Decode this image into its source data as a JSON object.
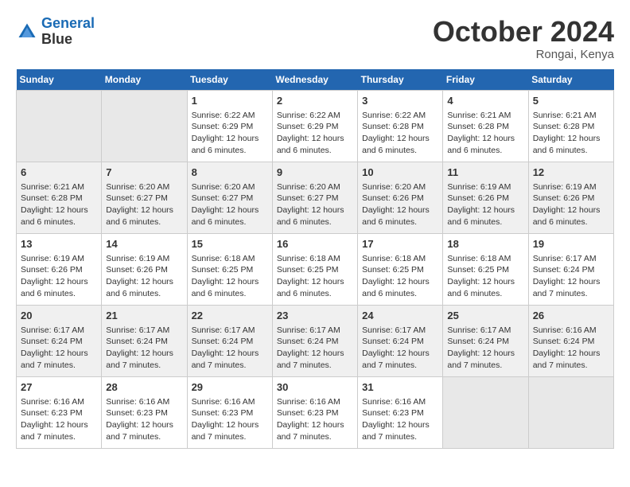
{
  "header": {
    "logo_line1": "General",
    "logo_line2": "Blue",
    "month": "October 2024",
    "location": "Rongai, Kenya"
  },
  "weekdays": [
    "Sunday",
    "Monday",
    "Tuesday",
    "Wednesday",
    "Thursday",
    "Friday",
    "Saturday"
  ],
  "weeks": [
    [
      {
        "day": "",
        "info": ""
      },
      {
        "day": "",
        "info": ""
      },
      {
        "day": "1",
        "info": "Sunrise: 6:22 AM\nSunset: 6:29 PM\nDaylight: 12 hours and 6 minutes."
      },
      {
        "day": "2",
        "info": "Sunrise: 6:22 AM\nSunset: 6:29 PM\nDaylight: 12 hours and 6 minutes."
      },
      {
        "day": "3",
        "info": "Sunrise: 6:22 AM\nSunset: 6:28 PM\nDaylight: 12 hours and 6 minutes."
      },
      {
        "day": "4",
        "info": "Sunrise: 6:21 AM\nSunset: 6:28 PM\nDaylight: 12 hours and 6 minutes."
      },
      {
        "day": "5",
        "info": "Sunrise: 6:21 AM\nSunset: 6:28 PM\nDaylight: 12 hours and 6 minutes."
      }
    ],
    [
      {
        "day": "6",
        "info": "Sunrise: 6:21 AM\nSunset: 6:28 PM\nDaylight: 12 hours and 6 minutes."
      },
      {
        "day": "7",
        "info": "Sunrise: 6:20 AM\nSunset: 6:27 PM\nDaylight: 12 hours and 6 minutes."
      },
      {
        "day": "8",
        "info": "Sunrise: 6:20 AM\nSunset: 6:27 PM\nDaylight: 12 hours and 6 minutes."
      },
      {
        "day": "9",
        "info": "Sunrise: 6:20 AM\nSunset: 6:27 PM\nDaylight: 12 hours and 6 minutes."
      },
      {
        "day": "10",
        "info": "Sunrise: 6:20 AM\nSunset: 6:26 PM\nDaylight: 12 hours and 6 minutes."
      },
      {
        "day": "11",
        "info": "Sunrise: 6:19 AM\nSunset: 6:26 PM\nDaylight: 12 hours and 6 minutes."
      },
      {
        "day": "12",
        "info": "Sunrise: 6:19 AM\nSunset: 6:26 PM\nDaylight: 12 hours and 6 minutes."
      }
    ],
    [
      {
        "day": "13",
        "info": "Sunrise: 6:19 AM\nSunset: 6:26 PM\nDaylight: 12 hours and 6 minutes."
      },
      {
        "day": "14",
        "info": "Sunrise: 6:19 AM\nSunset: 6:26 PM\nDaylight: 12 hours and 6 minutes."
      },
      {
        "day": "15",
        "info": "Sunrise: 6:18 AM\nSunset: 6:25 PM\nDaylight: 12 hours and 6 minutes."
      },
      {
        "day": "16",
        "info": "Sunrise: 6:18 AM\nSunset: 6:25 PM\nDaylight: 12 hours and 6 minutes."
      },
      {
        "day": "17",
        "info": "Sunrise: 6:18 AM\nSunset: 6:25 PM\nDaylight: 12 hours and 6 minutes."
      },
      {
        "day": "18",
        "info": "Sunrise: 6:18 AM\nSunset: 6:25 PM\nDaylight: 12 hours and 6 minutes."
      },
      {
        "day": "19",
        "info": "Sunrise: 6:17 AM\nSunset: 6:24 PM\nDaylight: 12 hours and 7 minutes."
      }
    ],
    [
      {
        "day": "20",
        "info": "Sunrise: 6:17 AM\nSunset: 6:24 PM\nDaylight: 12 hours and 7 minutes."
      },
      {
        "day": "21",
        "info": "Sunrise: 6:17 AM\nSunset: 6:24 PM\nDaylight: 12 hours and 7 minutes."
      },
      {
        "day": "22",
        "info": "Sunrise: 6:17 AM\nSunset: 6:24 PM\nDaylight: 12 hours and 7 minutes."
      },
      {
        "day": "23",
        "info": "Sunrise: 6:17 AM\nSunset: 6:24 PM\nDaylight: 12 hours and 7 minutes."
      },
      {
        "day": "24",
        "info": "Sunrise: 6:17 AM\nSunset: 6:24 PM\nDaylight: 12 hours and 7 minutes."
      },
      {
        "day": "25",
        "info": "Sunrise: 6:17 AM\nSunset: 6:24 PM\nDaylight: 12 hours and 7 minutes."
      },
      {
        "day": "26",
        "info": "Sunrise: 6:16 AM\nSunset: 6:24 PM\nDaylight: 12 hours and 7 minutes."
      }
    ],
    [
      {
        "day": "27",
        "info": "Sunrise: 6:16 AM\nSunset: 6:23 PM\nDaylight: 12 hours and 7 minutes."
      },
      {
        "day": "28",
        "info": "Sunrise: 6:16 AM\nSunset: 6:23 PM\nDaylight: 12 hours and 7 minutes."
      },
      {
        "day": "29",
        "info": "Sunrise: 6:16 AM\nSunset: 6:23 PM\nDaylight: 12 hours and 7 minutes."
      },
      {
        "day": "30",
        "info": "Sunrise: 6:16 AM\nSunset: 6:23 PM\nDaylight: 12 hours and 7 minutes."
      },
      {
        "day": "31",
        "info": "Sunrise: 6:16 AM\nSunset: 6:23 PM\nDaylight: 12 hours and 7 minutes."
      },
      {
        "day": "",
        "info": ""
      },
      {
        "day": "",
        "info": ""
      }
    ]
  ]
}
